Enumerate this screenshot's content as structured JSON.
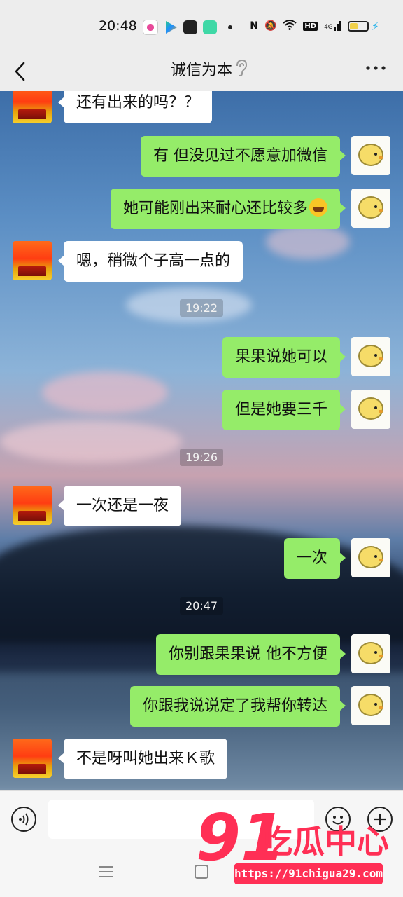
{
  "status_bar": {
    "time": "20:48",
    "network_badge": "HD",
    "network_type": "4G",
    "battery_level": 0.45,
    "battery_color": "#f1d14a",
    "charging_color": "#28b3ea"
  },
  "header": {
    "title": "诚信为本"
  },
  "messages": [
    {
      "side": "them",
      "text": "还有出来的吗？？"
    },
    {
      "side": "me",
      "text": "有 但没见过不愿意加微信"
    },
    {
      "side": "me",
      "text": "她可能刚出来耐心还比较多",
      "emoji": "rolling-on-floor-laughing"
    },
    {
      "side": "them",
      "text": "嗯，稍微个子高一点的"
    },
    {
      "side": "me",
      "text": "果果说她可以"
    },
    {
      "side": "me",
      "text": "但是她要三千"
    },
    {
      "side": "them",
      "text": "一次还是一夜"
    },
    {
      "side": "me",
      "text": "一次"
    },
    {
      "side": "me",
      "text": "你别跟果果说 他不方便"
    },
    {
      "side": "me",
      "text": "你跟我说说定了我帮你转达"
    },
    {
      "side": "them",
      "text": "不是呀叫她出来Ｋ歌"
    }
  ],
  "timestamps": [
    "19:22",
    "19:26",
    "20:47"
  ],
  "colors": {
    "my_bubble": "#95ec69",
    "their_bubble": "#ffffff",
    "watermark": "#ff2f55"
  },
  "watermark": {
    "number": "91",
    "text": "吃瓜中心",
    "url": "https://91chigua29.com"
  }
}
